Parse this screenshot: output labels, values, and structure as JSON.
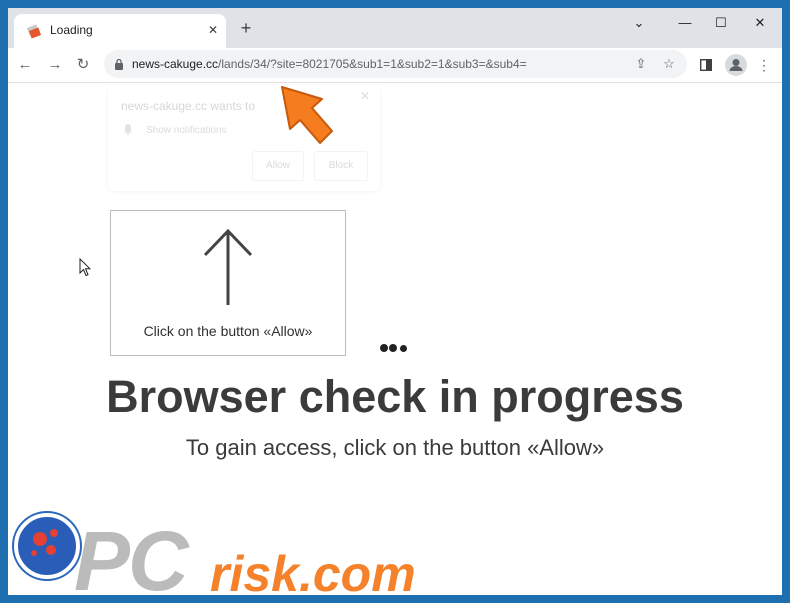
{
  "tab": {
    "title": "Loading",
    "close": "✕",
    "new_tab": "+"
  },
  "window_controls": {
    "collapse": "⌄",
    "minimize": "—",
    "maximize": "☐",
    "close": "✕"
  },
  "toolbar": {
    "back": "←",
    "forward": "→",
    "reload": "↻",
    "url_host": "news-cakuge.cc",
    "url_path": "/lands/34/?site=8021705&sub1=1&sub2=1&sub3=&sub4=",
    "share": "⇪",
    "star": "☆",
    "menu": "⋮"
  },
  "notification": {
    "title": "news-cakuge.cc wants to",
    "text": "Show notifications",
    "allow": "Allow",
    "block": "Block",
    "close": "✕"
  },
  "prompt_box": {
    "label": "Click on the button «Allow»"
  },
  "main": {
    "headline": "Browser check in progress",
    "subline": "To gain access, click on the button «Allow»"
  },
  "watermark": {
    "pc": "PC",
    "risk": "risk.com"
  },
  "colors": {
    "accent_orange": "#f57c1f",
    "watermark_gray": "#b8b8b8",
    "frame_blue": "#1e6fb0"
  }
}
